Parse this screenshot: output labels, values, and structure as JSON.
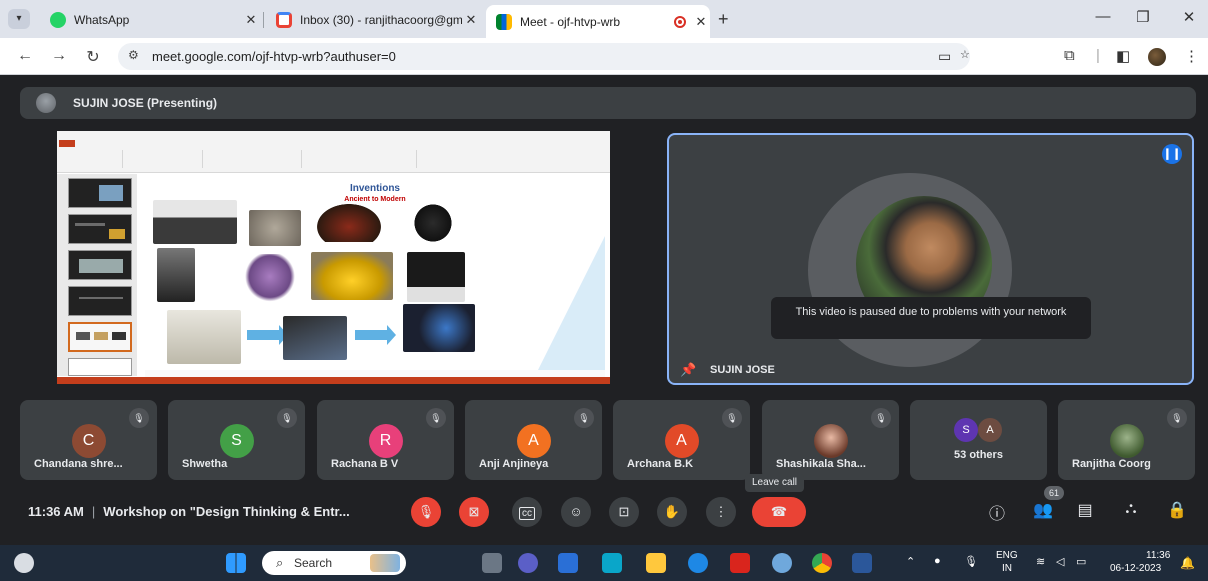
{
  "browser": {
    "tabs": [
      {
        "title": "WhatsApp",
        "favicon": "whatsapp-icon"
      },
      {
        "title": "Inbox (30) - ranjithacoorg@gm",
        "favicon": "gmail-icon"
      },
      {
        "title": "Meet - ojf-htvp-wrb",
        "favicon": "meet-icon",
        "active": true
      }
    ],
    "url": "meet.google.com/ojf-htvp-wrb?authuser=0"
  },
  "meet": {
    "presenter_label": "SUJIN JOSE (Presenting)",
    "slide": {
      "title": "Inventions",
      "subtitle": "Ancient to Modern"
    },
    "speaker": {
      "name": "SUJIN JOSE",
      "notice": "This video is paused due to problems with your network"
    },
    "participants": [
      {
        "name": "Chandana shre...",
        "initial": "C",
        "color": "#8d4a33"
      },
      {
        "name": "Shwetha",
        "initial": "S",
        "color": "#43a047"
      },
      {
        "name": "Rachana B V",
        "initial": "R",
        "color": "#e8407a"
      },
      {
        "name": "Anji Anjineya",
        "initial": "A",
        "color": "#f27121"
      },
      {
        "name": "Archana B.K",
        "initial": "A",
        "color": "#e24a28"
      },
      {
        "name": "Shashikala Sha...",
        "initial": "",
        "color": "#b07c6a"
      },
      {
        "name": "53 others",
        "initial": "",
        "color": "#3c4043",
        "mini": [
          "S",
          "A"
        ]
      },
      {
        "name": "Ranjitha Coorg",
        "initial": "",
        "color": "#5b7b4a"
      }
    ],
    "tooltip": "Leave call",
    "time": "11:36 AM",
    "meeting_title": "Workshop on \"Design Thinking & Entr...",
    "people_count": "61",
    "accent": "#ea4335",
    "highlight": "#8ab4f8"
  },
  "taskbar": {
    "search_placeholder": "Search",
    "language": "ENG",
    "language_sub": "IN",
    "clock_time": "11:36",
    "clock_date": "06-12-2023"
  }
}
